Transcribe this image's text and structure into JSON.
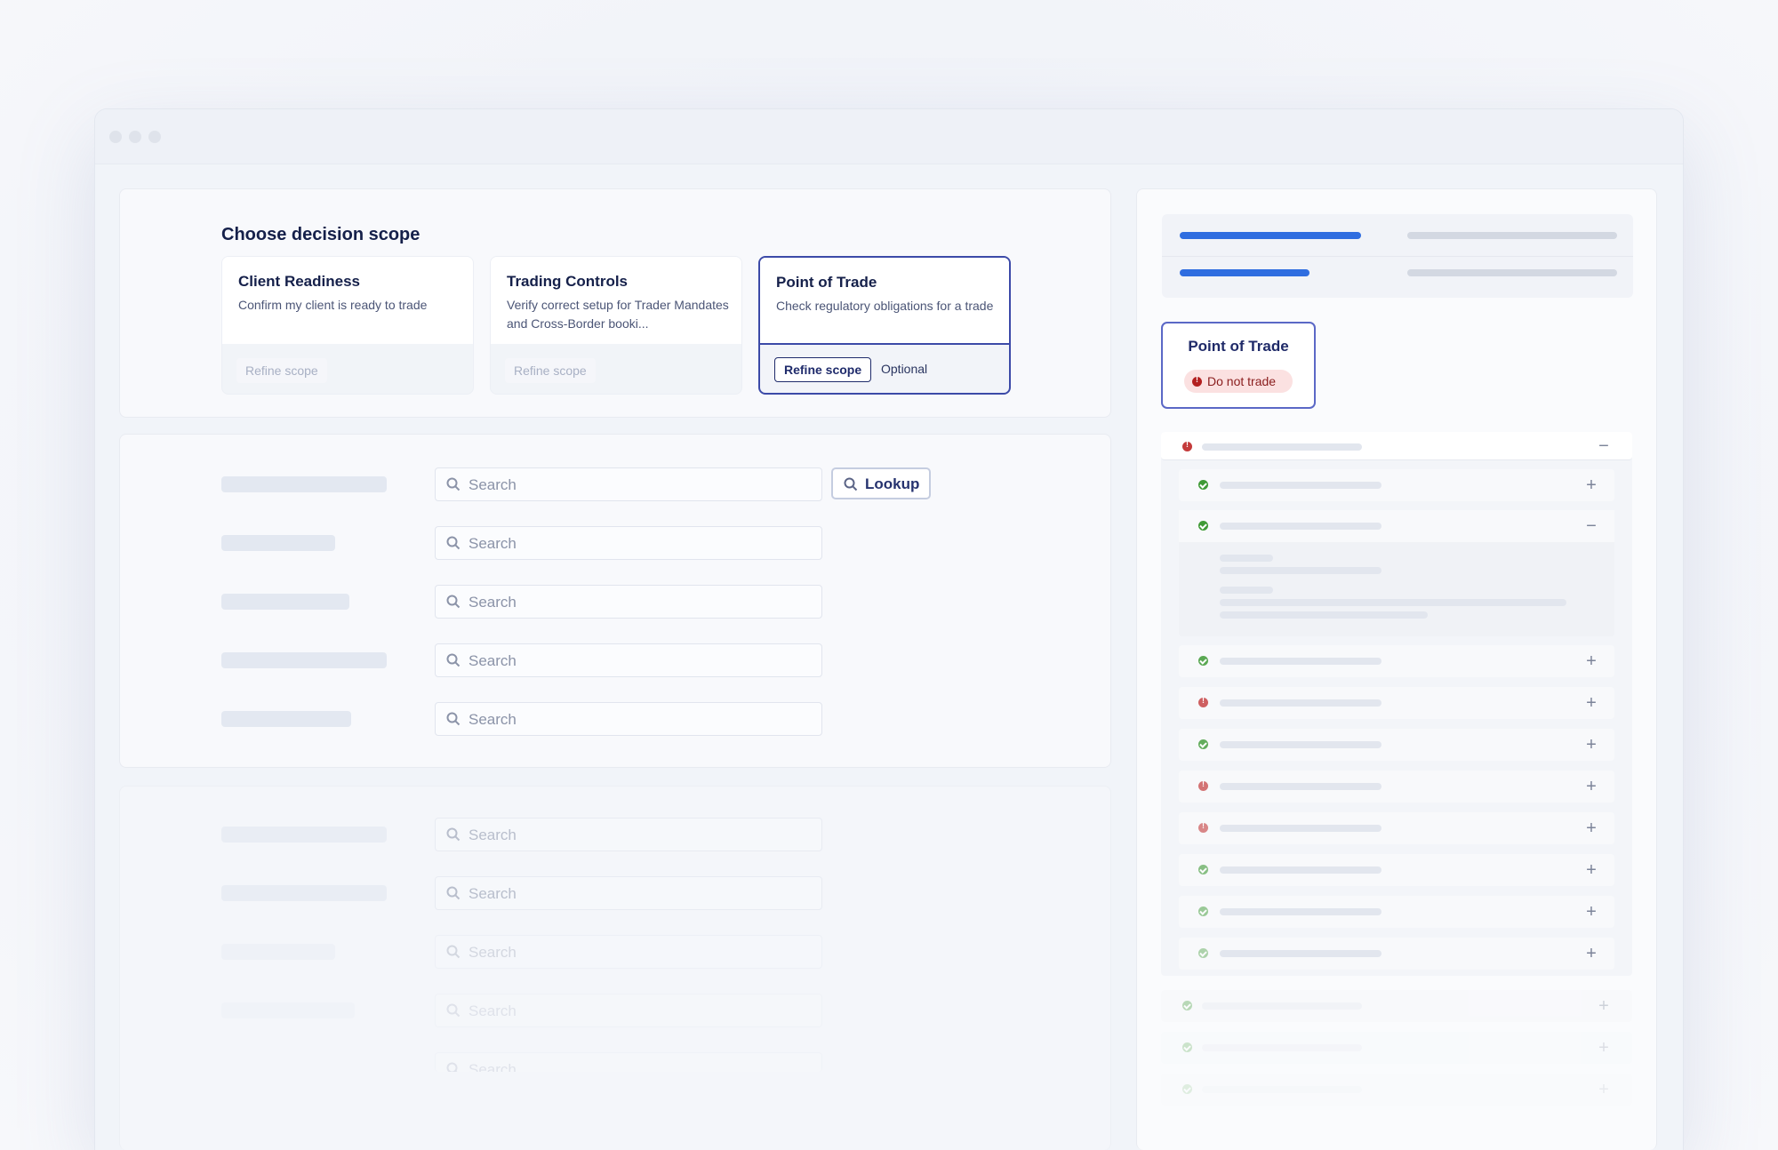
{
  "scope": {
    "heading": "Choose decision scope",
    "cards": [
      {
        "title": "Client Readiness",
        "description": "Confirm my client is ready to trade",
        "refine_label": "Refine scope"
      },
      {
        "title": "Trading Controls",
        "description": "Verify correct setup for Trader Mandates and Cross-Border booki...",
        "refine_label": "Refine scope"
      },
      {
        "title": "Point of Trade",
        "description": "Check regulatory obligations for a trade",
        "refine_label": "Refine scope",
        "optional_label": "Optional",
        "selected": true
      }
    ]
  },
  "search_form": {
    "placeholder": "Search",
    "lookup_label": "Lookup"
  },
  "result": {
    "title": "Point of Trade",
    "status_label": "Do not trade"
  },
  "colors": {
    "accent": "#3c4aa8",
    "progress_blue": "#2f6de0",
    "ok": "#3f9a36",
    "error": "#c43b3b",
    "badge_bg": "#fbe1e1"
  },
  "checks": {
    "group_status": "error",
    "items": [
      "ok",
      "ok",
      "ok",
      "error",
      "ok",
      "error",
      "error",
      "ok",
      "ok",
      "ok"
    ],
    "trailing": [
      "ok",
      "ok",
      "ok"
    ]
  }
}
